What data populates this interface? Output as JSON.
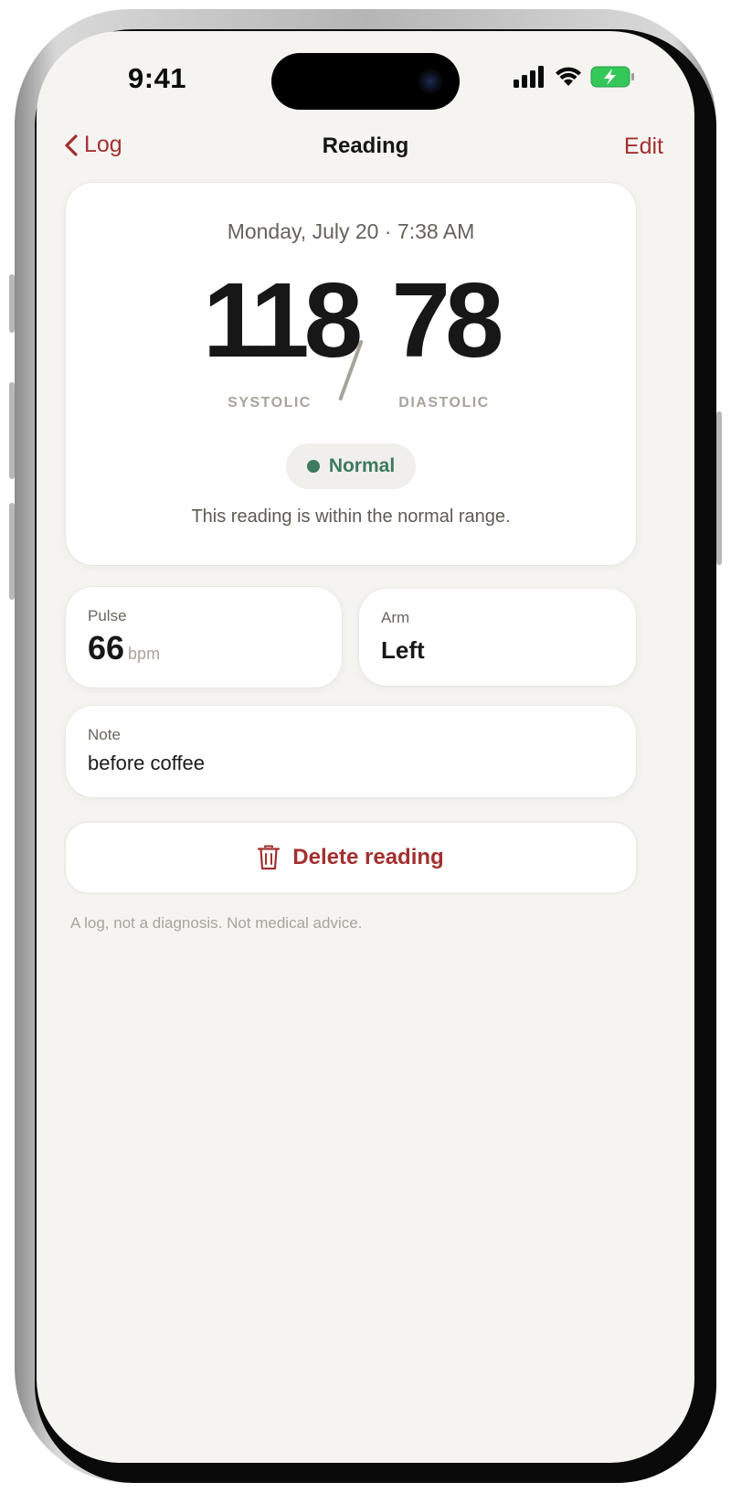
{
  "status_bar": {
    "time": "9:41"
  },
  "nav": {
    "back_label": "Log",
    "title": "Reading",
    "edit_label": "Edit"
  },
  "reading": {
    "datetime": "Monday, July 20 · 7:38 AM",
    "systolic": "118",
    "diastolic": "78",
    "systolic_label": "SYSTOLIC",
    "diastolic_label": "DIASTOLIC",
    "status": "Normal",
    "status_description": "This reading is within the normal range."
  },
  "pulse": {
    "label": "Pulse",
    "value": "66",
    "unit": "bpm"
  },
  "arm": {
    "label": "Arm",
    "value": "Left"
  },
  "note": {
    "label": "Note",
    "value": "before coffee"
  },
  "actions": {
    "delete_label": "Delete reading"
  },
  "footer": {
    "disclaimer": "A log, not a diagnosis. Not medical advice."
  },
  "colors": {
    "accent": "#a33030",
    "normal_status": "#3d7a5e",
    "background": "#f5f4f1"
  },
  "icons": {
    "back": "chevron-left-icon",
    "delete": "trash-icon",
    "signal": "cellular-signal-icon",
    "wifi": "wifi-icon",
    "battery": "battery-charging-icon"
  }
}
